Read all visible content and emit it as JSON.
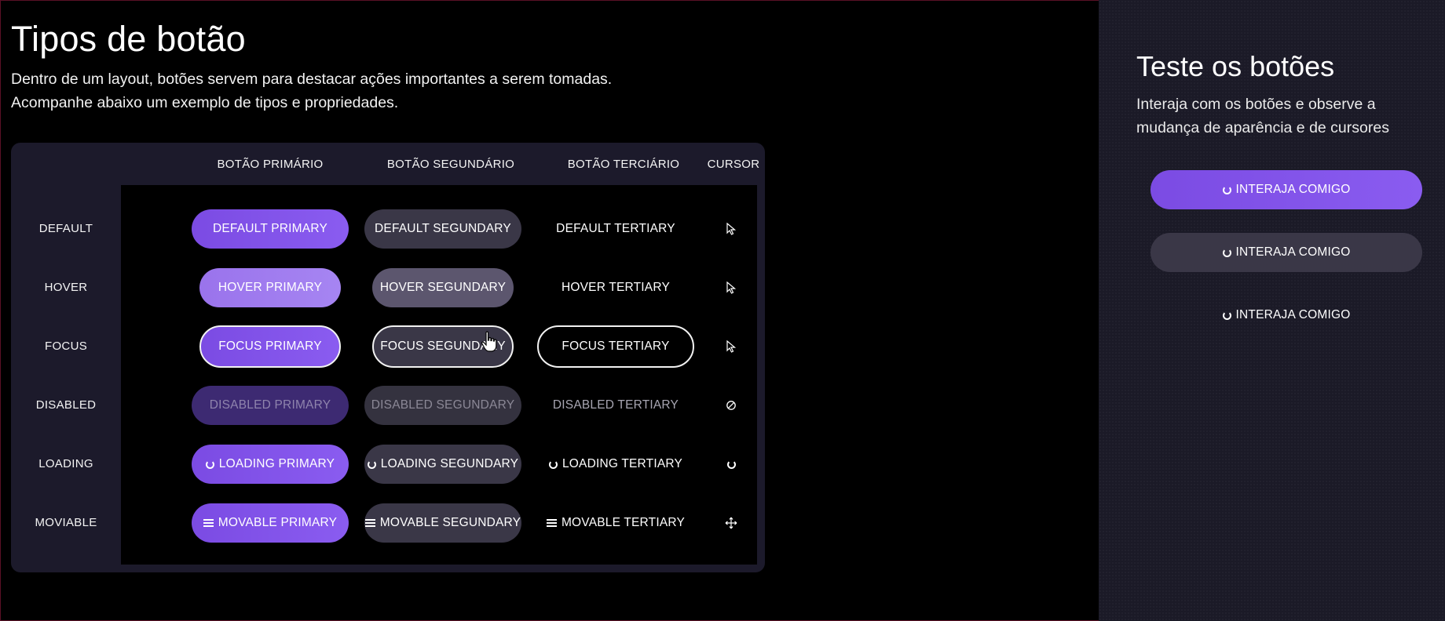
{
  "header": {
    "title": "Tipos de botão",
    "description_line1": "Dentro de um layout, botões servem para destacar ações importantes a serem tomadas.",
    "description_line2": "Acompanhe abaixo um exemplo de tipos e propriedades."
  },
  "table": {
    "columns": [
      "BOTÃO PRIMÁRIO",
      "BOTÃO SEGUNDÁRIO",
      "BOTÃO TERCIÁRIO",
      "CURSOR"
    ],
    "rows": [
      {
        "label": "DEFAULT",
        "primary": "DEFAULT PRIMARY",
        "secondary": "DEFAULT SEGUNDARY",
        "tertiary": "DEFAULT TERTIARY",
        "cursor_icon": "arrow-cursor-icon"
      },
      {
        "label": "HOVER",
        "primary": "HOVER PRIMARY",
        "secondary": "HOVER SEGUNDARY",
        "tertiary": "HOVER TERTIARY",
        "cursor_icon": "arrow-cursor-icon"
      },
      {
        "label": "FOCUS",
        "primary": "FOCUS PRIMARY",
        "secondary": "FOCUS SEGUNDARY",
        "tertiary": "FOCUS TERTIARY",
        "cursor_icon": "arrow-cursor-icon"
      },
      {
        "label": "DISABLED",
        "primary": "DISABLED PRIMARY",
        "secondary": "DISABLED SEGUNDARY",
        "tertiary": "DISABLED TERTIARY",
        "cursor_icon": "not-allowed-icon"
      },
      {
        "label": "LOADING",
        "primary": "LOADING PRIMARY",
        "secondary": "LOADING SEGUNDARY",
        "tertiary": "LOADING TERTIARY",
        "cursor_icon": "spinner-icon"
      },
      {
        "label": "MOVIABLE",
        "primary": "MOVABLE PRIMARY",
        "secondary": "MOVABLE SEGUNDARY",
        "tertiary": "MOVABLE TERTIARY",
        "cursor_icon": "move-icon"
      }
    ]
  },
  "test_panel": {
    "title": "Teste os botões",
    "description": "Interaja com os botões e observe a mudança de aparência e de cursores",
    "primary_button": "INTERAJA COMIGO",
    "secondary_button": "INTERAJA COMIGO",
    "tertiary_button": "INTERAJA COMIGO"
  },
  "colors": {
    "primary": "#7b4be3",
    "primary_hover": "#9a73ec",
    "secondary": "#3a3747",
    "panel_bg": "#1c1a2b",
    "side_bg": "#1b1a27"
  }
}
